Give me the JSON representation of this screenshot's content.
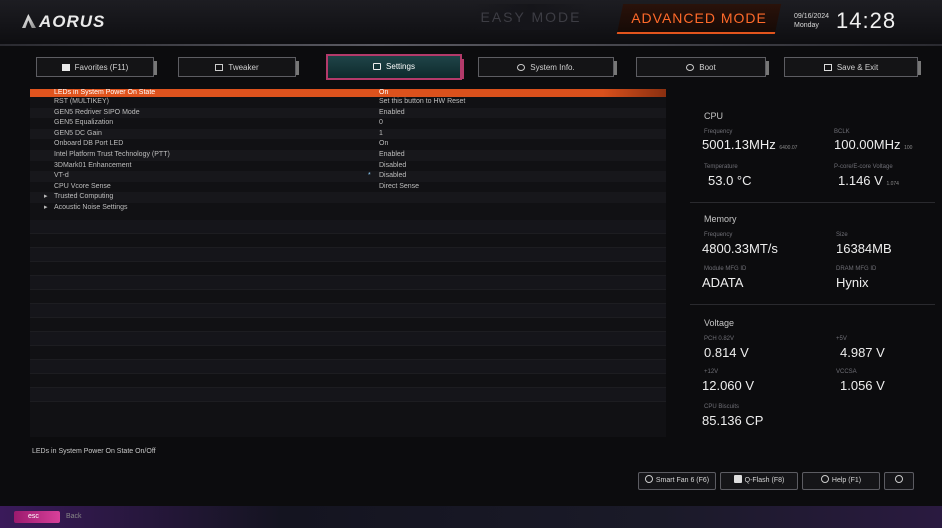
{
  "header": {
    "logo_text": "AORUS",
    "mode_easy": "EASY MODE",
    "mode_advanced": "ADVANCED MODE",
    "date": "09/16/2024",
    "weekday": "Monday",
    "time": "14:28"
  },
  "tabs": [
    {
      "label": "Favorites (F11)",
      "icon": "star-icon"
    },
    {
      "label": "Tweaker",
      "icon": "tweaker-icon"
    },
    {
      "label": "Settings",
      "icon": "settings-icon"
    },
    {
      "label": "System Info.",
      "icon": "info-icon"
    },
    {
      "label": "Boot",
      "icon": "power-icon"
    },
    {
      "label": "Save & Exit",
      "icon": "exit-icon"
    }
  ],
  "settings": [
    {
      "name": "LEDs in System Power On State",
      "value": "On",
      "selected": true
    },
    {
      "name": "RST (MULTIKEY)",
      "value": "Set this button to HW Reset"
    },
    {
      "name": "GEN5 Redriver SIPO Mode",
      "value": "Enabled"
    },
    {
      "name": "GEN5 Equalization",
      "value": "0"
    },
    {
      "name": "GEN5 DC Gain",
      "value": "1"
    },
    {
      "name": "Onboard DB Port LED",
      "value": "On"
    },
    {
      "name": "Intel Platform Trust Technology (PTT)",
      "value": "Enabled"
    },
    {
      "name": "3DMark01 Enhancement",
      "value": "Disabled"
    },
    {
      "name": "VT-d",
      "value": "Disabled",
      "marker": "*"
    },
    {
      "name": "CPU Vcore Sense",
      "value": "Direct Sense"
    },
    {
      "name": "Trusted Computing",
      "submenu": true
    },
    {
      "name": "Acoustic Noise Settings",
      "submenu": true
    }
  ],
  "info_panel": {
    "cpu": {
      "title": "CPU",
      "frequency_label": "Frequency",
      "frequency": "5001.13MHz",
      "frequency_suffix": "6400.07",
      "bclk_label": "BCLK",
      "bclk": "100.00MHz",
      "bclk_suffix": "100",
      "temperature_label": "Temperature",
      "temperature": "53.0 °C",
      "vcore_label": "P-core/E-core Voltage",
      "vcore": "1.146 V",
      "vcore_suffix": "1.074"
    },
    "memory": {
      "title": "Memory",
      "frequency_label": "Frequency",
      "frequency": "4800.33MT/s",
      "size_label": "Size",
      "size": "16384MB",
      "module_label": "Module MFG ID",
      "module": "ADATA",
      "dram_label": "DRAM MFG ID",
      "dram": "Hynix"
    },
    "voltage": {
      "title": "Voltage",
      "pch_label": "PCH 0.82V",
      "pch": "0.814 V",
      "v5_label": "+5V",
      "v5": "4.987 V",
      "v12_label": "+12V",
      "v12": "12.060 V",
      "vccsa_label": "VCCSA",
      "vccsa": "1.056 V",
      "cpu_biscuits_label": "CPU Biscuits",
      "cpu_biscuits": "85.136 CP"
    }
  },
  "help_text": "LEDs in System Power On State On/Off",
  "footer_buttons": [
    {
      "label": "Smart Fan 6 (F6)",
      "icon": "fan-icon"
    },
    {
      "label": "Q-Flash (F8)",
      "icon": "flash-icon"
    },
    {
      "label": "Help (F1)",
      "icon": "help-icon"
    },
    {
      "label": "",
      "icon": "search-icon"
    }
  ],
  "bottom": {
    "esc": "esc",
    "back": "Back"
  },
  "colors": {
    "accent": "#e1541d",
    "active_tab_border": "#b33a6a",
    "active_tab_fill": "#1f4448",
    "esc": "#d8409a"
  }
}
